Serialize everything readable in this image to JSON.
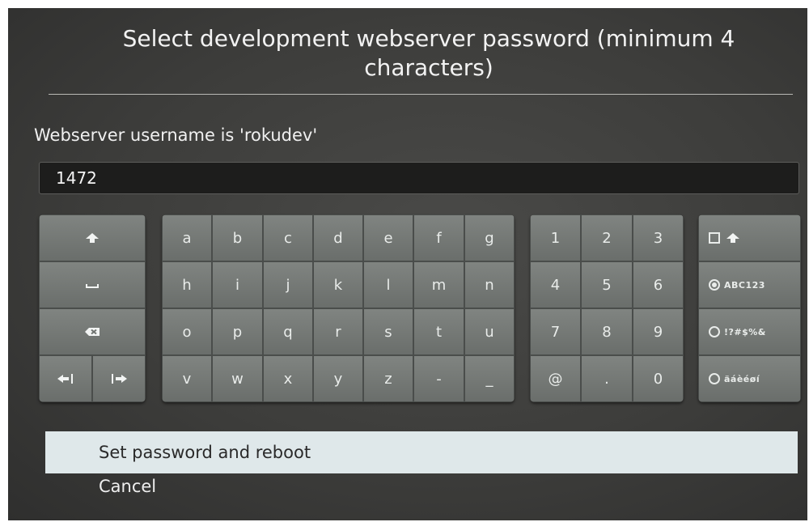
{
  "dialog": {
    "title": "Select development webserver password (minimum 4 characters)",
    "username_label": "Webserver username is 'rokudev'",
    "password_value": "1472"
  },
  "keyboard": {
    "letters": [
      [
        "a",
        "b",
        "c",
        "d",
        "e",
        "f",
        "g"
      ],
      [
        "h",
        "i",
        "j",
        "k",
        "l",
        "m",
        "n"
      ],
      [
        "o",
        "p",
        "q",
        "r",
        "s",
        "t",
        "u"
      ],
      [
        "v",
        "w",
        "x",
        "y",
        "z",
        "-",
        "_"
      ]
    ],
    "numbers": [
      [
        "1",
        "2",
        "3"
      ],
      [
        "4",
        "5",
        "6"
      ],
      [
        "7",
        "8",
        "9"
      ],
      [
        "@",
        ".",
        "0"
      ]
    ],
    "control_icons": [
      "shift-icon",
      "space-icon",
      "backspace-icon",
      "cursor-left-icon",
      "cursor-right-icon"
    ],
    "modes": [
      {
        "icon": "caps-lock-icon",
        "label": "",
        "selected": false
      },
      {
        "icon": "radio-icon",
        "label": "ABC123",
        "selected": true
      },
      {
        "icon": "radio-icon",
        "label": "!?#$%&",
        "selected": false
      },
      {
        "icon": "radio-icon",
        "label": "äáèéøí",
        "selected": false
      }
    ]
  },
  "actions": {
    "set_password": "Set password and reboot",
    "cancel": "Cancel"
  },
  "colors": {
    "screen_background": "#3d3d3b",
    "key_face": "#767a77",
    "selected_menu_item": "#dfe8ea",
    "text": "#f0f0f0"
  }
}
